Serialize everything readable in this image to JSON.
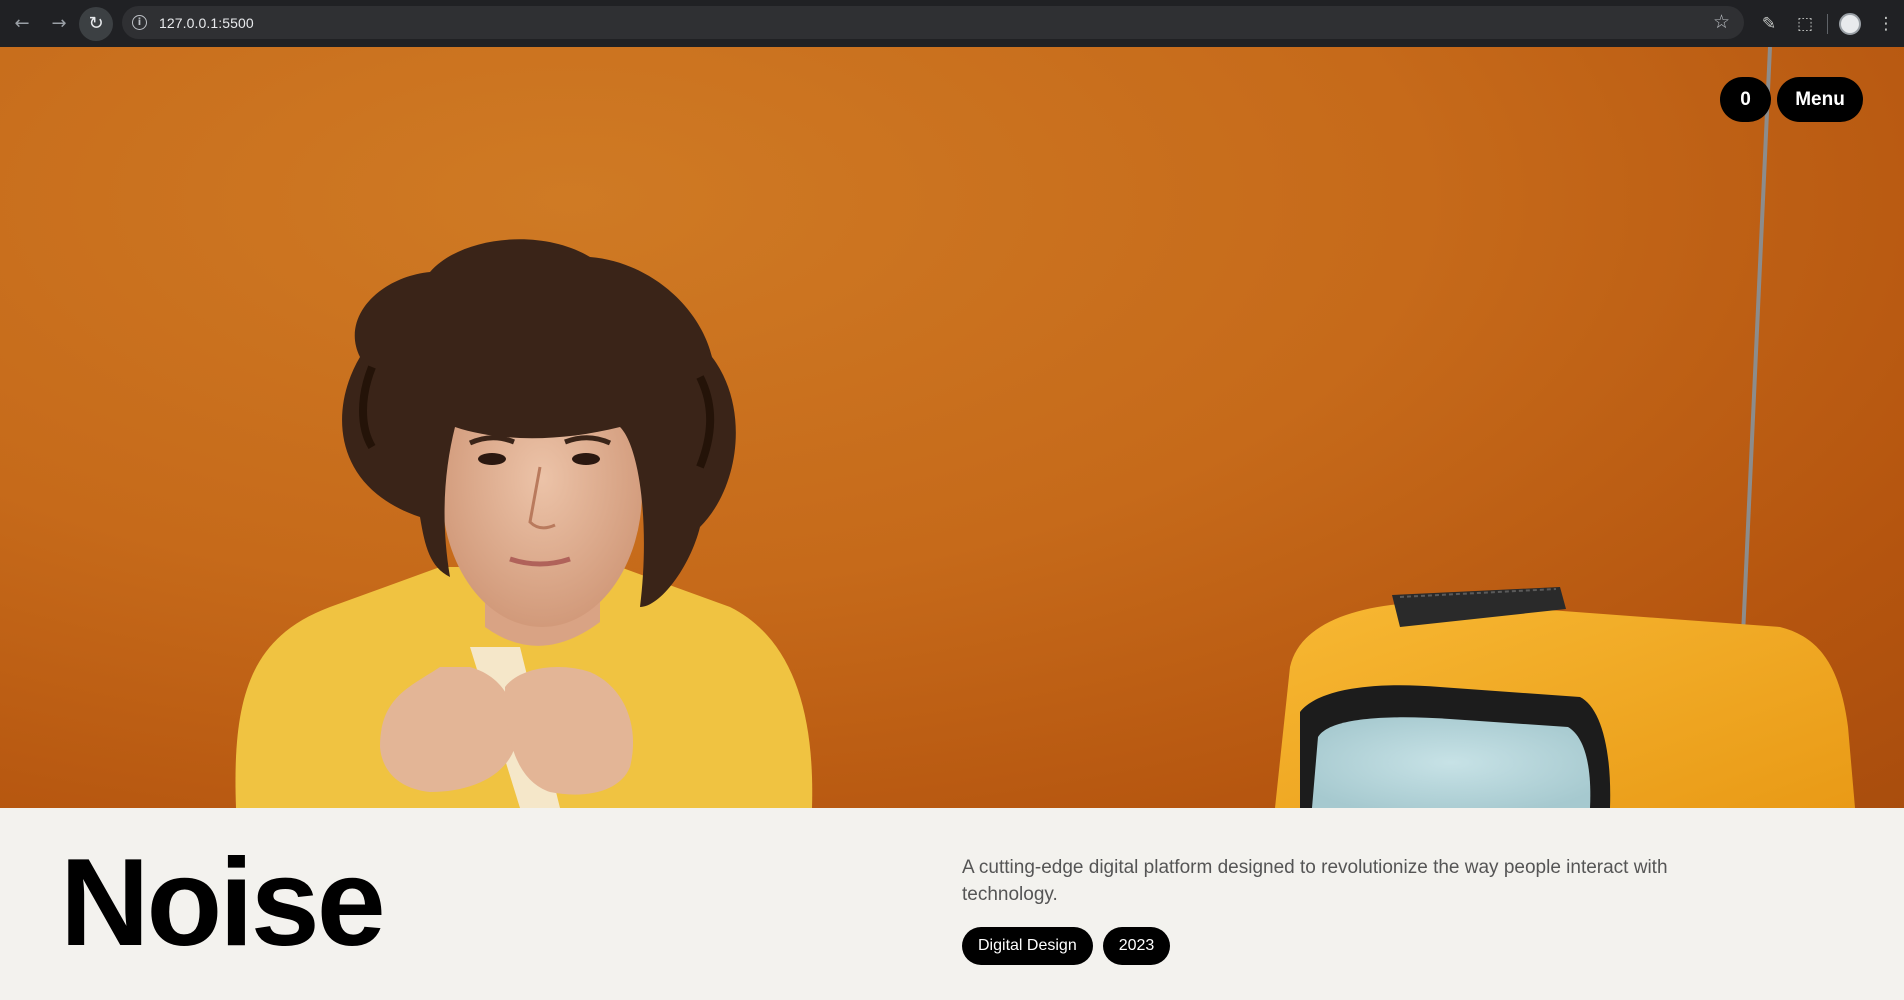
{
  "browser": {
    "url": "127.0.0.1:5500"
  },
  "hero": {
    "count": "0",
    "menu_label": "Menu"
  },
  "project": {
    "title": "Noise",
    "description": "A cutting-edge digital platform designed to revolutionize the way people interact with technology.",
    "tags": [
      "Digital Design",
      "2023"
    ]
  },
  "colors": {
    "background": "#c66a1a",
    "panel": "#f3f2ee",
    "button": "#000000"
  }
}
